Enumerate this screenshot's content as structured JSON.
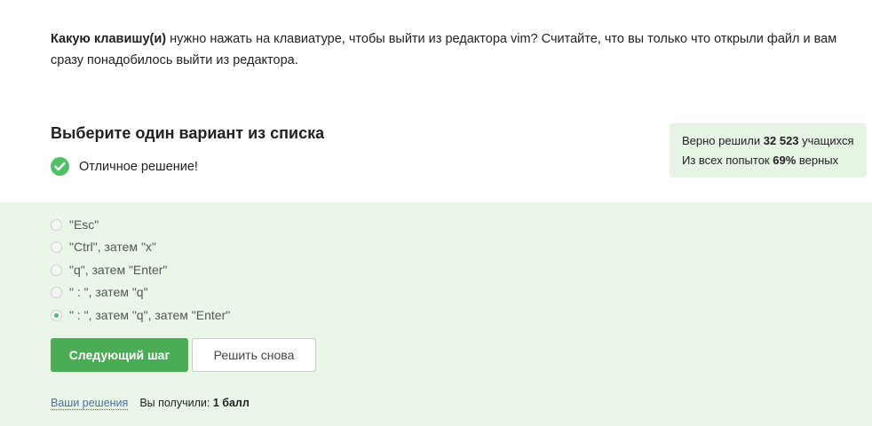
{
  "question": {
    "bold": "Какую клавишу(и)",
    "text": " нужно нажать на клавиатуре, чтобы выйти из редактора vim? Считайте, что вы только что открыли файл и вам сразу понадобилось выйти из редактора."
  },
  "choose_title": "Выберите один вариант из списка",
  "feedback": {
    "icon": "check-circle-icon",
    "text": "Отличное решение!"
  },
  "stats": {
    "line1_prefix": "Верно решили ",
    "solved_count": "32 523",
    "line1_suffix": " учащихся",
    "line2_prefix": "Из всех попыток ",
    "percent": "69%",
    "line2_suffix": " верных"
  },
  "options": [
    {
      "label": "\"Esc\"",
      "selected": false
    },
    {
      "label": "\"Ctrl\", затем \"x\"",
      "selected": false
    },
    {
      "label": "\"q\", затем \"Enter\"",
      "selected": false
    },
    {
      "label": "\" : \", затем \"q\"",
      "selected": false
    },
    {
      "label": "\" : \", затем \"q\", затем \"Enter\"",
      "selected": true
    }
  ],
  "buttons": {
    "next": "Следующий шаг",
    "retry": "Решить снова"
  },
  "footer": {
    "solutions_link": "Ваши решения",
    "score_prefix": "Вы получили: ",
    "score_value": "1 балл"
  },
  "colors": {
    "accent": "#4ec165",
    "button": "#4aac55",
    "answers_bg": "#e9f6e8",
    "stats_bg": "#e6f4e4",
    "link": "#4a6fa8"
  }
}
